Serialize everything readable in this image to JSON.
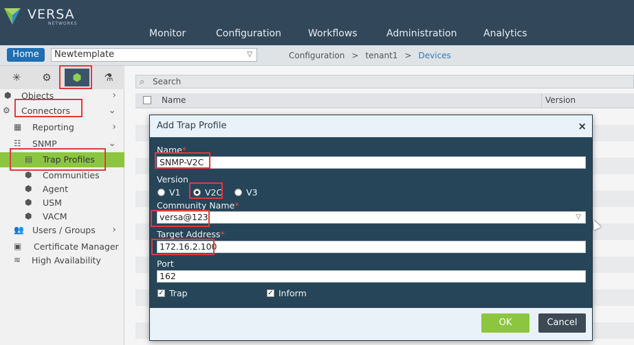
{
  "brand": {
    "name": "VERSA",
    "sub": "NETWORKS",
    "colors": {
      "nav_bg": "#33475b",
      "accent_green": "#8cc63f",
      "primary_blue": "#1f6fb2",
      "modal_bg": "#274558",
      "highlight_red": "#e0393e"
    }
  },
  "nav": {
    "items": [
      "Monitor",
      "Configuration",
      "Workflows",
      "Administration",
      "Analytics"
    ]
  },
  "toolbar": {
    "home": "Home",
    "template": "Newtemplate"
  },
  "breadcrumb": {
    "items": [
      "Configuration",
      "tenant1",
      "Devices"
    ],
    "sep": ">"
  },
  "sidebar": {
    "tabs": [
      {
        "icon": "network-icon",
        "glyph": "✳"
      },
      {
        "icon": "gear-icon",
        "glyph": "⚙"
      },
      {
        "icon": "cube-icon",
        "glyph": "⬢"
      },
      {
        "icon": "globe-gear-icon",
        "glyph": "⚗"
      }
    ],
    "items": [
      {
        "label": "Objects",
        "icon": "cube-icon",
        "glyph": "⬢",
        "arrow": "›"
      },
      {
        "label": "Connectors",
        "icon": "gears-icon",
        "glyph": "⚙",
        "arrow": "⌄"
      },
      {
        "label": "Reporting",
        "icon": "report-icon",
        "glyph": "▦",
        "arrow": "›"
      },
      {
        "label": "SNMP",
        "icon": "snmp-icon",
        "glyph": "☷",
        "arrow": "⌄"
      },
      {
        "label": "Trap Profiles",
        "icon": "trap-icon",
        "glyph": "▤",
        "arrow": ""
      },
      {
        "label": "Communities",
        "icon": "cube-icon",
        "glyph": "⬢",
        "arrow": ""
      },
      {
        "label": "Agent",
        "icon": "cube-icon",
        "glyph": "⬢",
        "arrow": ""
      },
      {
        "label": "USM",
        "icon": "cube-icon",
        "glyph": "⬢",
        "arrow": ""
      },
      {
        "label": "VACM",
        "icon": "cube-icon",
        "glyph": "⬢",
        "arrow": ""
      },
      {
        "label": "Users / Groups",
        "icon": "users-icon",
        "glyph": "👥",
        "arrow": "›"
      },
      {
        "label": "Certificate Manager",
        "icon": "certificate-icon",
        "glyph": "▣",
        "arrow": ""
      },
      {
        "label": "High Availability",
        "icon": "ha-icon",
        "glyph": "≋",
        "arrow": ""
      }
    ]
  },
  "list": {
    "search_placeholder": "Search",
    "columns": [
      "Name",
      "Version"
    ]
  },
  "modal": {
    "title": "Add Trap Profile",
    "close": "×",
    "name_label": "Name",
    "name_value": "SNMP-V2C",
    "required_mark": "*",
    "version_label": "Version",
    "versions": [
      "V1",
      "V2C",
      "V3"
    ],
    "version_selected": "V2C",
    "community_label": "Community Name",
    "community_value": "versa@123",
    "target_label": "Target Address",
    "target_value": "172.16.2.100",
    "port_label": "Port",
    "port_value": "162",
    "trap_label": "Trap",
    "trap_checked": true,
    "inform_label": "Inform",
    "inform_checked": true,
    "ok": "OK",
    "cancel": "Cancel"
  }
}
